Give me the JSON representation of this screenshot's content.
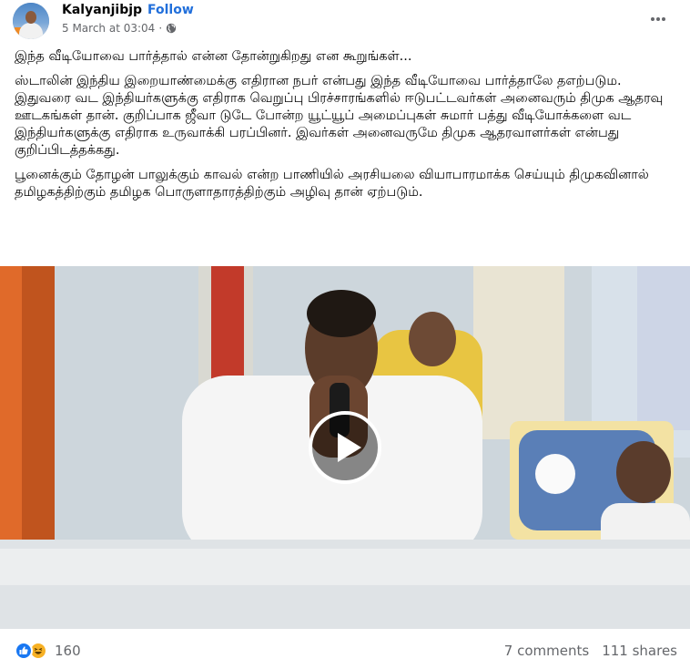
{
  "post": {
    "author": "Kalyanjibjp",
    "separator": "·",
    "follow_label": "Follow",
    "timestamp": "5 March at 03:04",
    "meta_separator": "·",
    "privacy_icon": "globe-icon",
    "more_icon": "more-options-icon",
    "paragraphs": [
      "இந்த வீடியோவை பார்த்தால் என்ன தோன்றுகிறது என கூறுங்கள்...",
      "ஸ்டாலின் இந்திய இறையாண்மைக்கு எதிரான நபர் என்பது இந்த வீடியோவை பார்த்தாலே தஎற்படும. இதுவரை வட இந்தியர்களுக்கு எதிராக வெறுப்பு பிரச்சாரங்களில் ஈடுபட்டவர்கள் அனைவரும் திமுக ஆதரவு ஊடகங்கள் தான். குறிப்பாக ஜீவா டுடே போன்ற யூட்யூப் அமைப்புகள் சுமார் பத்து வீடியோக்களை வட இந்தியர்களுக்கு எதிராக உருவாக்கி பரப்பினர். இவர்கள் அனைவருமே திமுக ஆதரவாளர்கள் என்பது குறிப்பிடத்தக்கது.",
      "பூனைக்கும் தோழன் பாலுக்கும் காவல் என்ற பாணியில் அரசியலை வியாபாரமாக்க செய்யும் திமுகவினால் தமிழகத்திற்கும் தமிழக பொருளாதாரத்திற்கும் அழிவு தான் ஏற்படும்."
    ],
    "video": {
      "play_icon": "play-icon"
    },
    "reactions": {
      "icons": [
        "like-icon",
        "haha-icon"
      ],
      "count": "160"
    },
    "comments": "7 comments",
    "shares": "111 shares"
  },
  "colors": {
    "accent": "#216fdb",
    "secondary_text": "#65676b",
    "like": "#1877f2",
    "haha": "#f7b125"
  }
}
